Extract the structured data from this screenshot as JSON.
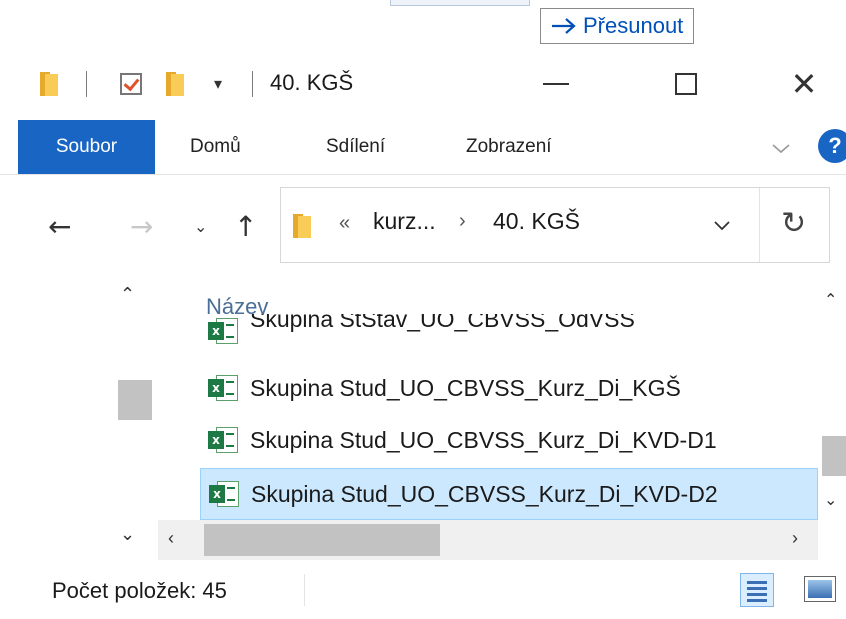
{
  "drag_tooltip": {
    "label": "Přesunout",
    "icon": "arrow-right-icon"
  },
  "window": {
    "title": "40. KGŠ",
    "quick_access": [
      "folder-icon",
      "properties-check-icon",
      "new-folder-icon",
      "customize-dropdown-icon"
    ],
    "controls": [
      "minimize-icon",
      "maximize-icon",
      "close-icon"
    ]
  },
  "ribbon": {
    "tabs": [
      "Soubor",
      "Domů",
      "Sdílení",
      "Zobrazení"
    ],
    "active_tab": "Soubor",
    "accent": "#1965c4",
    "help": "?"
  },
  "nav": {
    "buttons": [
      "back-arrow-icon",
      "forward-arrow-icon",
      "recent-dropdown-icon",
      "up-arrow-icon"
    ],
    "address": {
      "overflow": "«",
      "crumbs": [
        "kurz...",
        "40. KGŠ"
      ],
      "separator": "›"
    },
    "refresh": "refresh-icon"
  },
  "file_list": {
    "column_header": "Název",
    "items": [
      {
        "name": "Skupina StStav_UO_CBVSS_OdVSS",
        "icon": "excel-file-icon",
        "selected": false,
        "partially_visible": true
      },
      {
        "name": "Skupina Stud_UO_CBVSS_Kurz_Di_KGŠ",
        "icon": "excel-file-icon",
        "selected": false
      },
      {
        "name": "Skupina Stud_UO_CBVSS_Kurz_Di_KVD-D1",
        "icon": "excel-file-icon",
        "selected": false
      },
      {
        "name": "Skupina Stud_UO_CBVSS_Kurz_Di_KVD-D2",
        "icon": "excel-file-icon",
        "selected": true
      }
    ],
    "selection_color": "#cce8ff"
  },
  "status_bar": {
    "text": "Počet položek: 45",
    "views": [
      "details-view-icon",
      "large-icons-view-icon"
    ],
    "active_view": "details-view-icon"
  }
}
